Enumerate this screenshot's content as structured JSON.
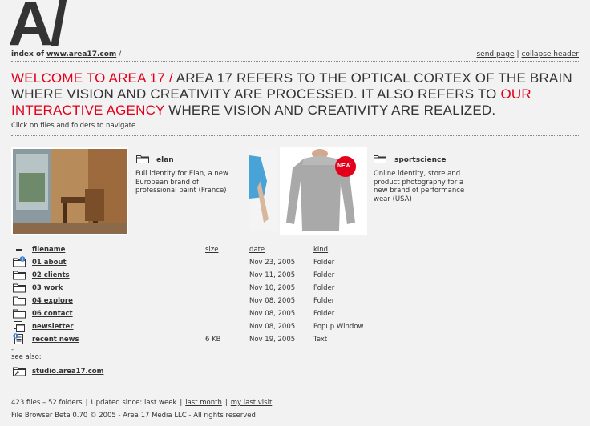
{
  "header": {
    "logo": "A/",
    "index_label": "index of",
    "domain_link": "www.area17.com",
    "path_suffix": "/",
    "send_page": "send page",
    "separator": "|",
    "collapse_header": "collapse header"
  },
  "welcome": {
    "red_lead": "WELCOME TO AREA 17 /",
    "text1": " AREA 17 REFERS TO THE OPTICAL CORTEX OF THE BRAIN WHERE VISION AND CREATIVITY ARE PROCESSED. IT ALSO REFERS TO ",
    "link": "OUR INTERACTIVE AGENCY",
    "text2": " WHERE VISION AND CREATIVITY ARE REALIZED."
  },
  "instruction": "Click on files and folders to navigate",
  "features": [
    {
      "title": "elan",
      "description": "Full identity for Elan, a new European brand of professional paint (France)"
    },
    {
      "title": "sportscience",
      "description": "Online identity, store and product photography for a new brand of performance wear (USA)",
      "badge": "NEW"
    }
  ],
  "listing": {
    "columns": {
      "filename": "filename",
      "size": "size",
      "date": "date",
      "kind": "kind"
    },
    "rows": [
      {
        "icon": "folder-new-icon",
        "name": "01 about",
        "size": "",
        "date": "Nov 23, 2005",
        "kind": "Folder"
      },
      {
        "icon": "folder-icon",
        "name": "02 clients",
        "size": "",
        "date": "Nov 11, 2005",
        "kind": "Folder"
      },
      {
        "icon": "folder-icon",
        "name": "03 work",
        "size": "",
        "date": "Nov 10, 2005",
        "kind": "Folder"
      },
      {
        "icon": "folder-icon",
        "name": "04 explore",
        "size": "",
        "date": "Nov 08, 2005",
        "kind": "Folder"
      },
      {
        "icon": "folder-icon",
        "name": "06 contact",
        "size": "",
        "date": "Nov 08, 2005",
        "kind": "Folder"
      },
      {
        "icon": "popup-window-icon",
        "name": "newsletter",
        "size": "",
        "date": "Nov 08, 2005",
        "kind": "Popup Window"
      },
      {
        "icon": "text-file-new-icon",
        "name": "recent news",
        "size": "6 KB",
        "date": "Nov 19, 2005",
        "kind": "Text"
      }
    ]
  },
  "dash": "-",
  "see_also": {
    "label": "see also:",
    "item": "studio.area17.com"
  },
  "footer": {
    "counts": "423 files – 52 folders",
    "sep": "|",
    "updated_label": "Updated since:",
    "last_week": "last week",
    "last_month": "last month",
    "last_visit": "my last visit",
    "copyright": "File Browser Beta 0.70 © 2005 - Area 17 Media LLC - All rights reserved"
  },
  "colors": {
    "accent_red": "#e2001a",
    "text": "#333333",
    "background": "#f2f2f2",
    "badge_blue": "#3a7fd0"
  }
}
